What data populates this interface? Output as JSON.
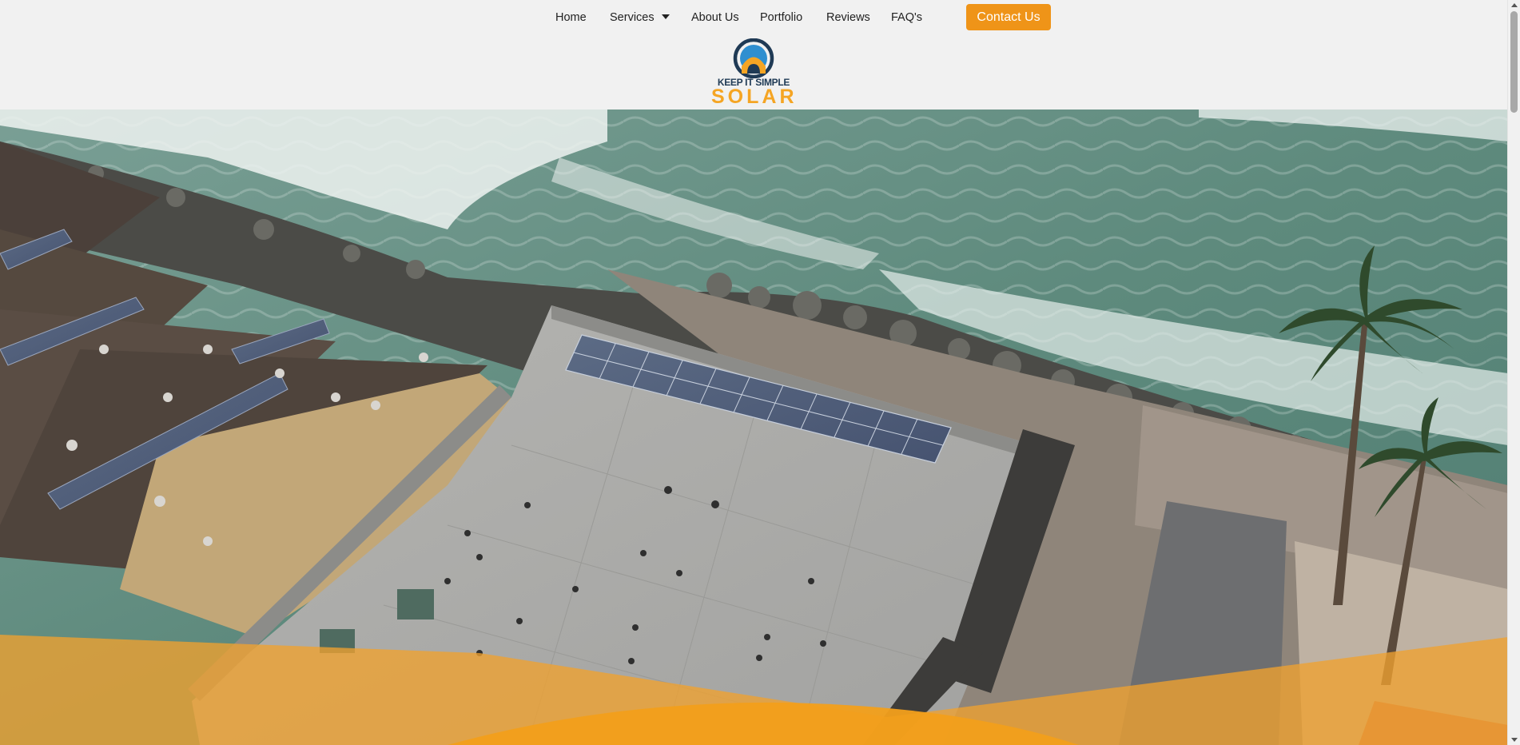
{
  "nav": {
    "home": "Home",
    "services": "Services",
    "about": "About Us",
    "portfolio": "Portfolio",
    "reviews": "Reviews",
    "faqs": "FAQ's",
    "contact": "Contact Us"
  },
  "logo": {
    "line1": "KEEP IT SIMPLE",
    "line2": "SOLAR"
  },
  "icons": {
    "services_dropdown": "caret-down-icon",
    "scroll_up": "arrow-up-icon",
    "scroll_down": "arrow-down-icon"
  },
  "colors": {
    "accent": "#ef9418",
    "logo_navy": "#1f3a55",
    "logo_orange": "#f5a524",
    "background": "#f1f1f1"
  }
}
